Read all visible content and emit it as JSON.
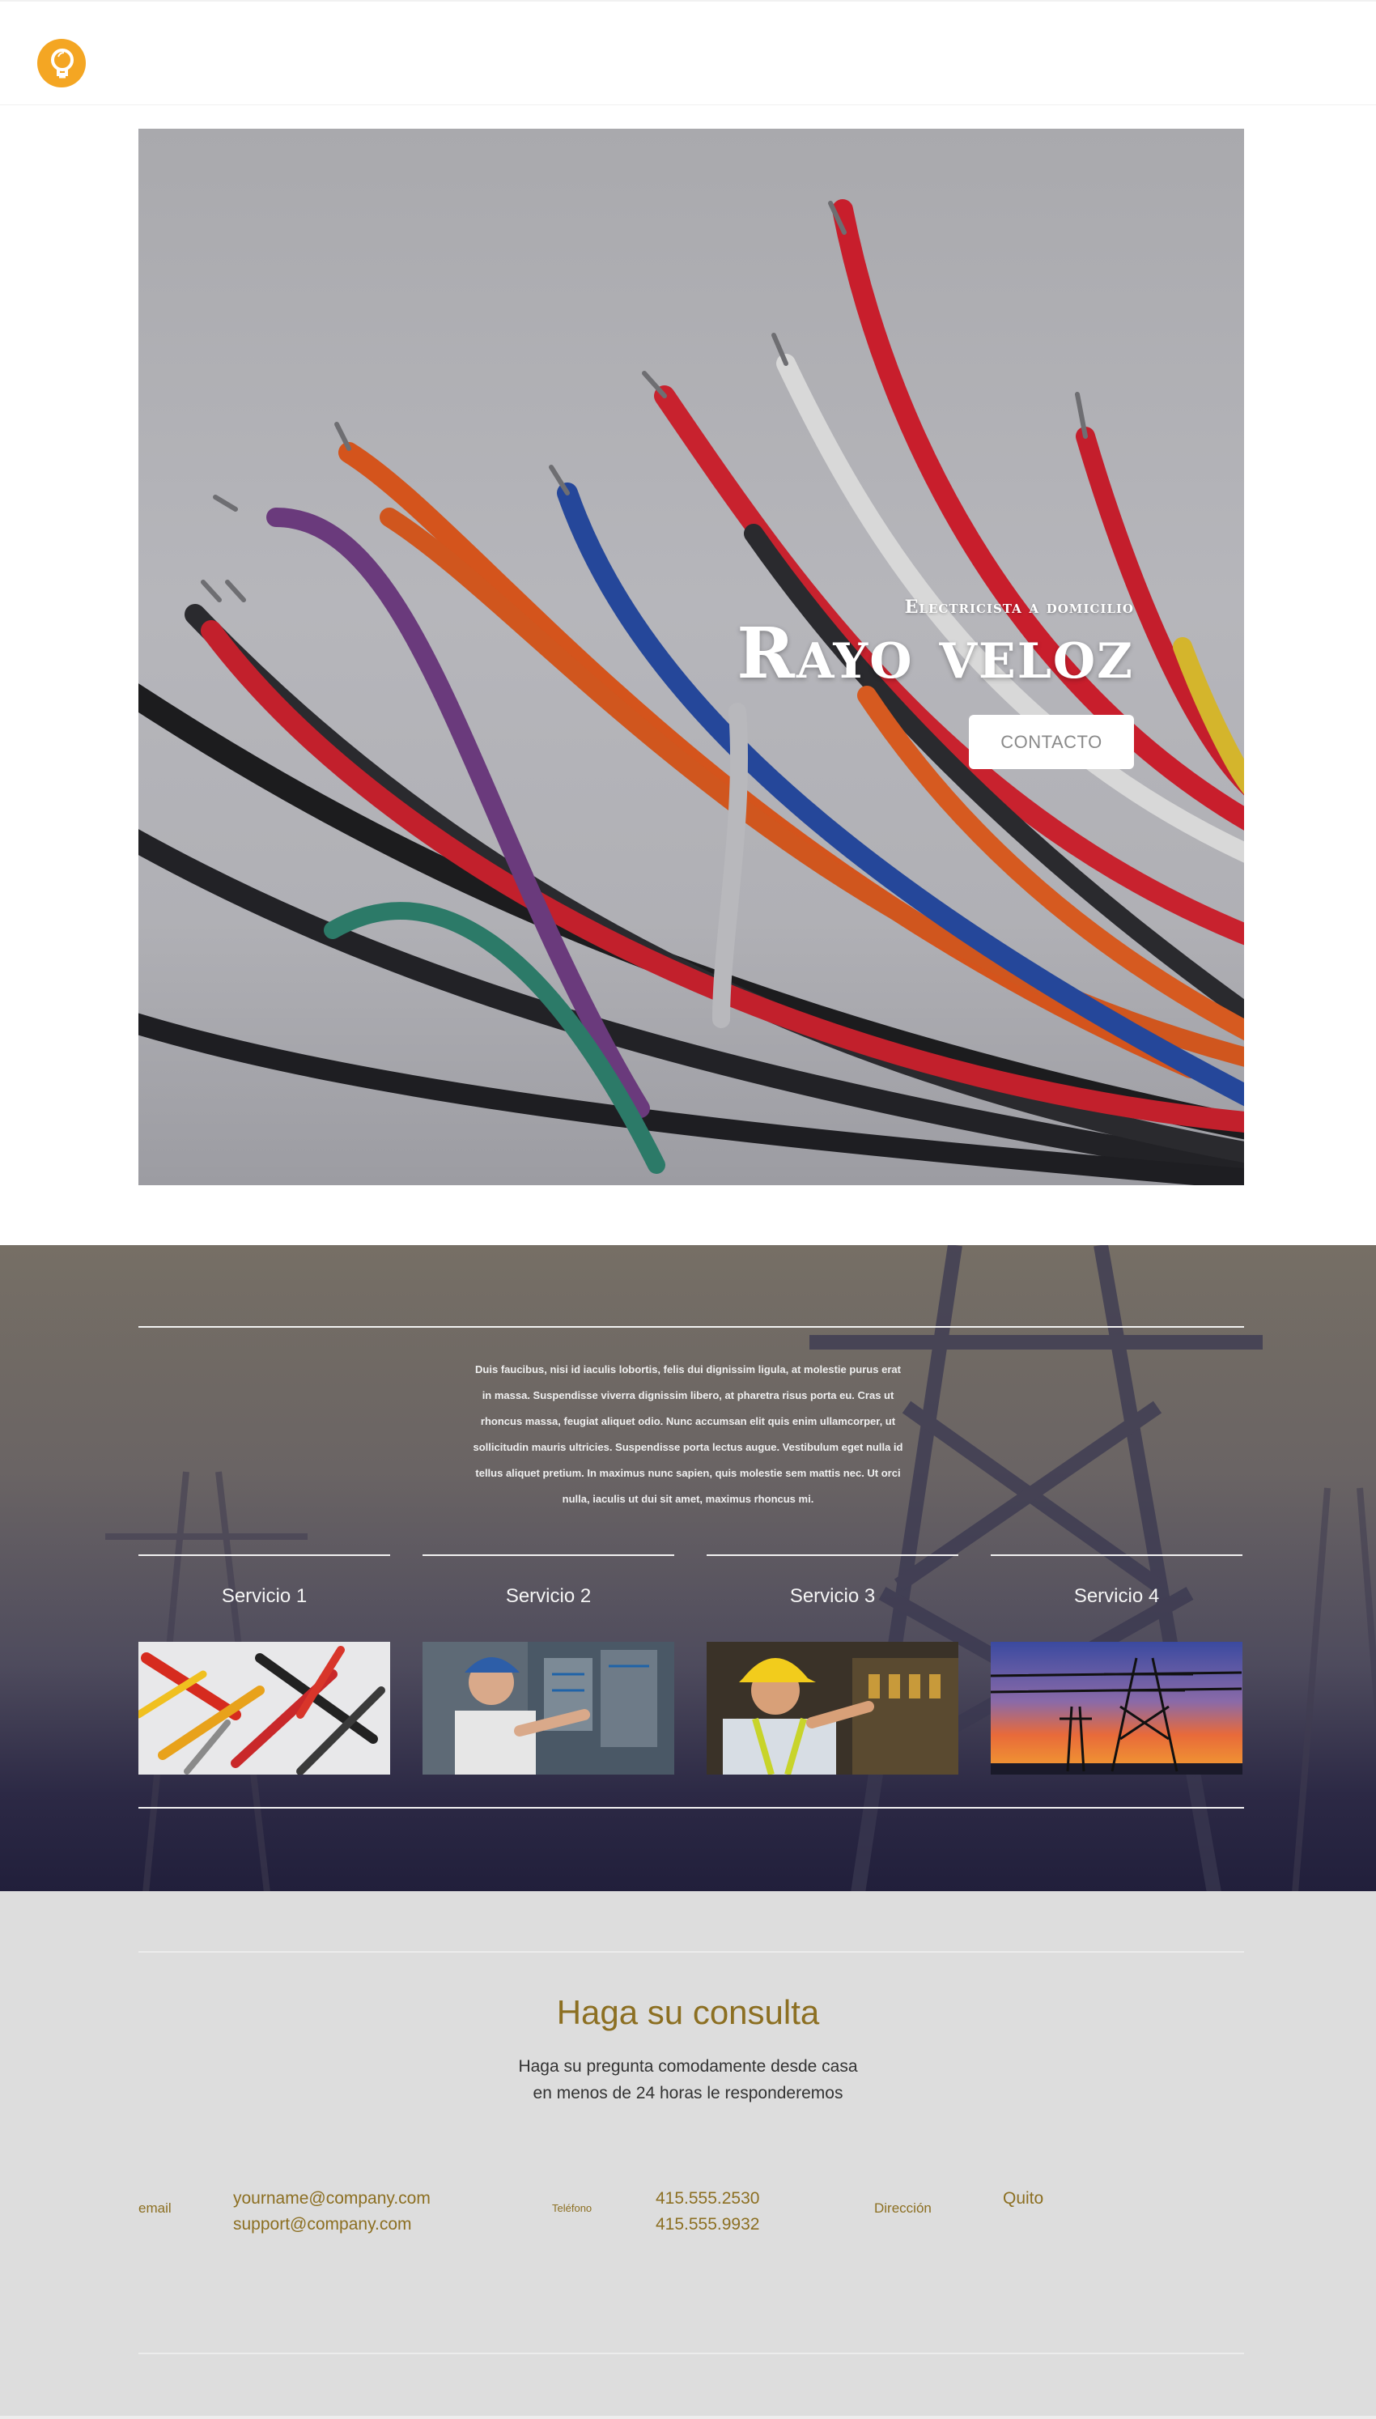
{
  "brand": {
    "logo_icon": "lightbulb-icon",
    "accent_color": "#f4a623"
  },
  "hero": {
    "subtitle": "Electricista a domicilio",
    "title": "Rayo veloz",
    "cta_label": "CONTACTO"
  },
  "services": {
    "intro": "Duis faucibus, nisi id iaculis lobortis, felis dui dignissim ligula, at molestie purus erat in massa. Suspendisse viverra dignissim libero, at pharetra risus porta eu. Cras ut rhoncus massa, feugiat aliquet odio. Nunc accumsan elit quis enim ullamcorper, ut sollicitudin mauris ultricies. Suspendisse porta lectus augue. Vestibulum eget nulla id tellus aliquet pretium. In maximus nunc sapien, quis molestie sem mattis nec. Ut orci nulla, iaculis ut dui sit amet, maximus rhoncus mi.",
    "items": [
      {
        "name": "Servicio 1"
      },
      {
        "name": "Servicio 2"
      },
      {
        "name": "Servicio 3"
      },
      {
        "name": "Servicio 4"
      }
    ]
  },
  "contact": {
    "title": "Haga su consulta",
    "subtitle_line1": "Haga su pregunta comodamente desde casa",
    "subtitle_line2": "en menos de 24 horas le responderemos",
    "email_label": "email",
    "email_1": "yourname@company.com",
    "email_2": "support@company.com",
    "phone_label": "Teléfono",
    "phone_1": "415.555.2530",
    "phone_2": "415.555.9932",
    "address_label": "Dirección",
    "address": "Quito",
    "title_color": "#8c6f22"
  }
}
